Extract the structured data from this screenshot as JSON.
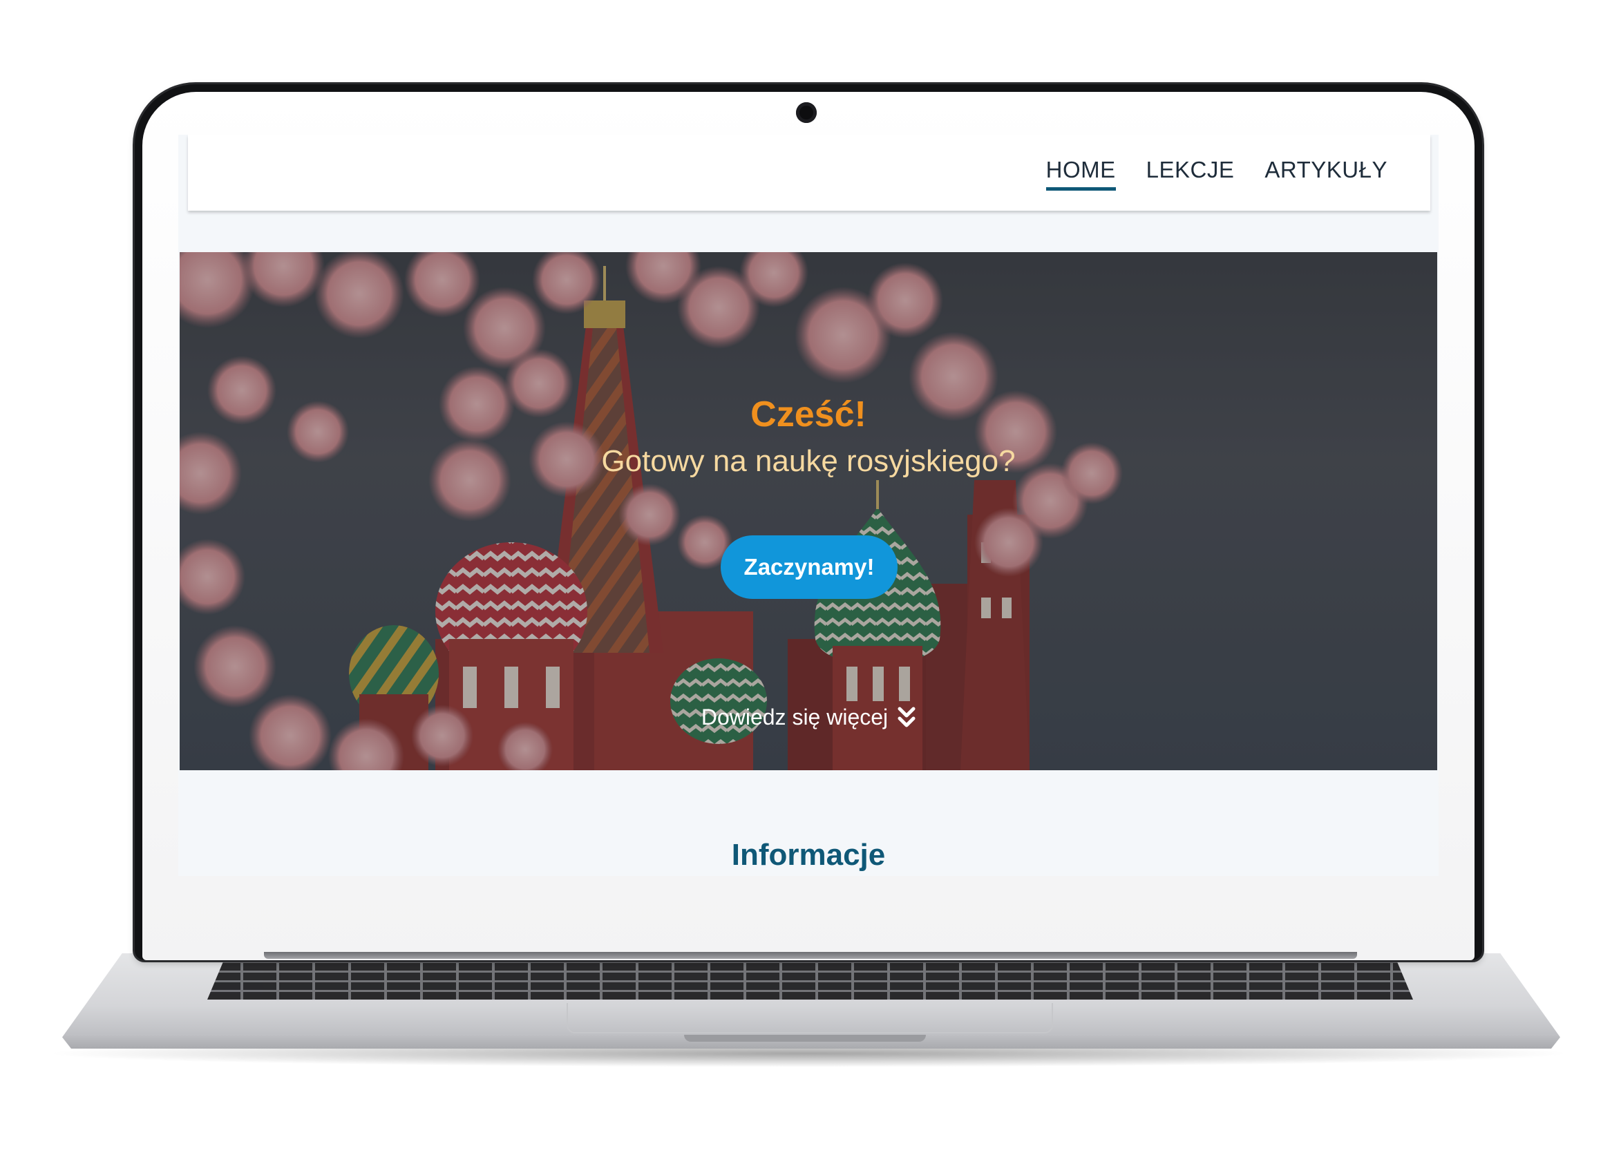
{
  "nav": {
    "items": [
      {
        "label": "HOME",
        "active": true
      },
      {
        "label": "LEKCJE",
        "active": false
      },
      {
        "label": "ARTYKUŁY",
        "active": false
      }
    ]
  },
  "hero": {
    "title": "Cześć!",
    "subtitle": "Gotowy na naukę rosyjskiego?",
    "cta_label": "Zaczynamy!",
    "learn_more_label": "Dowiedz się więcej",
    "learn_more_icon": "double-chevron-down-icon"
  },
  "section": {
    "title": "Informacje"
  },
  "colors": {
    "accent_orange": "#f0901e",
    "subtitle_cream": "#f6d9a0",
    "button_blue": "#1196da",
    "heading_blue": "#0f5877",
    "nav_text": "#1e2c3a"
  }
}
